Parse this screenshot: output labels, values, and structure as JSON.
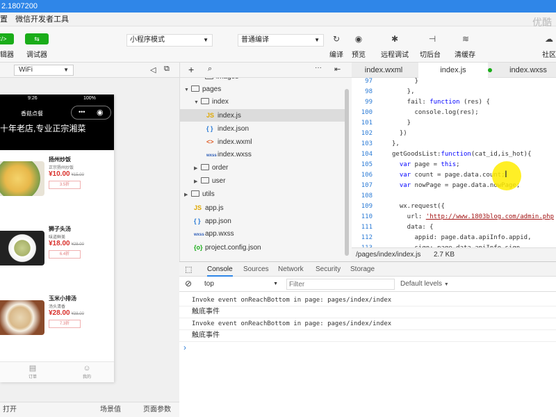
{
  "window": {
    "title": "2.1807200",
    "menu": [
      "置",
      "微信开发者工具"
    ],
    "watermark": "优酷"
  },
  "toolbar": {
    "left_buttons": [
      "辑器",
      "调试器"
    ],
    "mode": "小程序模式",
    "compile": "普通编译",
    "actions": [
      "编译",
      "预览",
      "远程调试",
      "切后台",
      "清缓存"
    ],
    "right_action": "社区"
  },
  "simulator": {
    "network": "WiFi",
    "time": "9:26",
    "battery": "100%",
    "nav_title": "香菇点餐",
    "banner": "十年老店,专业正宗湘菜",
    "items": [
      {
        "name": "扬州炒饭",
        "desc": "正宗扬州炒饭",
        "price": "¥10.00",
        "old": "¥15.00",
        "btn": "3.5折"
      },
      {
        "name": "狮子头汤",
        "desc": "味道鲜美",
        "price": "¥18.00",
        "old": "¥28.00",
        "btn": "6.4折"
      },
      {
        "name": "玉米小排汤",
        "desc": "汤头清香",
        "price": "¥28.00",
        "old": "¥38.00",
        "btn": "7.3折"
      }
    ],
    "tabs": [
      "订单",
      "我的"
    ],
    "footer": [
      "打开",
      "场景值",
      "页面参数"
    ]
  },
  "tree": {
    "items": [
      {
        "label": "images",
        "type": "folder"
      },
      {
        "label": "pages",
        "type": "folder"
      },
      {
        "label": "index",
        "type": "folder"
      },
      {
        "label": "index.js",
        "type": "js",
        "icon": "JS"
      },
      {
        "label": "index.json",
        "type": "json",
        "icon": "{ }"
      },
      {
        "label": "index.wxml",
        "type": "wxml",
        "icon": "<>"
      },
      {
        "label": "index.wxss",
        "type": "wxss",
        "icon": "wxss"
      },
      {
        "label": "order",
        "type": "folder"
      },
      {
        "label": "user",
        "type": "folder"
      },
      {
        "label": "utils",
        "type": "folder"
      },
      {
        "label": "app.js",
        "type": "js",
        "icon": "JS"
      },
      {
        "label": "app.json",
        "type": "json",
        "icon": "{ }"
      },
      {
        "label": "app.wxss",
        "type": "wxss",
        "icon": "wxss"
      },
      {
        "label": "project.config.json",
        "type": "cfg",
        "icon": "{o}"
      }
    ]
  },
  "editor": {
    "tabs": [
      "index.wxml",
      "index.js",
      "index.wxss"
    ],
    "lines": [
      {
        "n": "97",
        "code": "      }"
      },
      {
        "n": "98",
        "code": "    },"
      },
      {
        "n": "99",
        "code": "    fail: function (res) {"
      },
      {
        "n": "100",
        "code": "      console.log(res);"
      },
      {
        "n": "101",
        "code": "    }"
      },
      {
        "n": "102",
        "code": "  })"
      },
      {
        "n": "103",
        "code": "},"
      },
      {
        "n": "104",
        "code": "getGoodsList:function(cat_id,is_hot){"
      },
      {
        "n": "105",
        "code": "  var page = this;"
      },
      {
        "n": "106",
        "code": "  var count = page.data.count;"
      },
      {
        "n": "107",
        "code": "  var nowPage = page.data.nowPage;"
      },
      {
        "n": "108",
        "code": ""
      },
      {
        "n": "109",
        "code": "  wx.request({"
      },
      {
        "n": "110",
        "code": "    url: 'http://www.1803blog.com/admin.php"
      },
      {
        "n": "111",
        "code": "    data: {"
      },
      {
        "n": "112",
        "code": "      appid: page.data.apiInfo.appid,"
      },
      {
        "n": "113",
        "code": "      sign: page.data.apiInfo.sign,"
      }
    ],
    "path": "/pages/index/index.js",
    "size": "2.7 KB"
  },
  "console": {
    "tabs": [
      "Console",
      "Sources",
      "Network",
      "Security",
      "Storage"
    ],
    "context": "top",
    "filter_placeholder": "Filter",
    "levels": "Default levels",
    "lines": [
      "Invoke event onReachBottom in page: pages/index/index",
      "触底事件",
      "Invoke event onReachBottom in page: pages/index/index",
      "触底事件"
    ],
    "prompt": "›"
  }
}
